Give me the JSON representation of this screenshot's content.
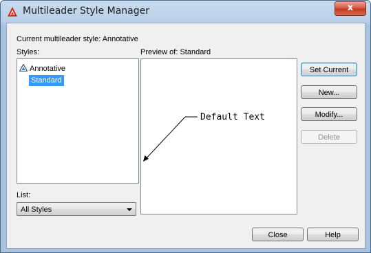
{
  "window": {
    "title": "Multileader Style Manager",
    "close_glyph": "x"
  },
  "current_style": "Current multileader style: Annotative",
  "styles_label": "Styles:",
  "styles": [
    {
      "label": "Annotative",
      "icon": "annotative-icon",
      "selected": false
    },
    {
      "label": "Standard",
      "selected": true
    }
  ],
  "preview_label": "Preview of: Standard",
  "preview_text": "Default Text",
  "list_label": "List:",
  "list_value": "All Styles",
  "buttons": {
    "set_current": "Set Current",
    "new": "New...",
    "modify": "Modify...",
    "delete": "Delete",
    "close": "Close",
    "help": "Help"
  },
  "colors": {
    "selection": "#3399ff",
    "app_icon": "#d6281a"
  }
}
